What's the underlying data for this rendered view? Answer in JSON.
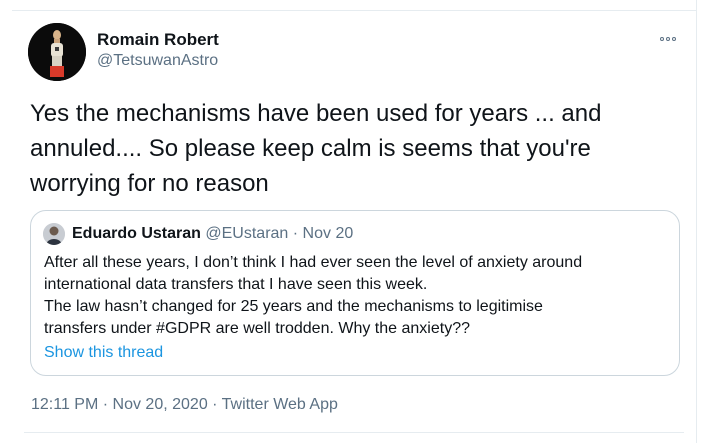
{
  "author": {
    "name": "Romain Robert",
    "handle": "@TetsuwanAstro"
  },
  "tweet": {
    "text": "Yes the mechanisms have been used for years ... and\nannuled.... So please keep calm is seems that you're\nworrying for no reason"
  },
  "quoted": {
    "name": "Eduardo Ustaran",
    "handle": "@EUstaran",
    "separator": "·",
    "date": "Nov 20",
    "lines": [
      "After all these years, I don’t think I had ever seen the level of anxiety around",
      "international data transfers that I have seen this week.",
      "The law hasn’t changed for 25 years and the mechanisms to legitimise",
      "transfers under #GDPR are well trodden. Why the anxiety??"
    ],
    "show_thread": "Show this thread"
  },
  "meta": {
    "time": "12:11 PM",
    "separator": "·",
    "date": "Nov 20, 2020",
    "app": "Twitter Web App"
  },
  "icons": {
    "more": "more-horizontal-icon"
  },
  "colors": {
    "secondary_text": "#5b7083",
    "link": "#1b95e0",
    "border": "#ccd6dd"
  }
}
